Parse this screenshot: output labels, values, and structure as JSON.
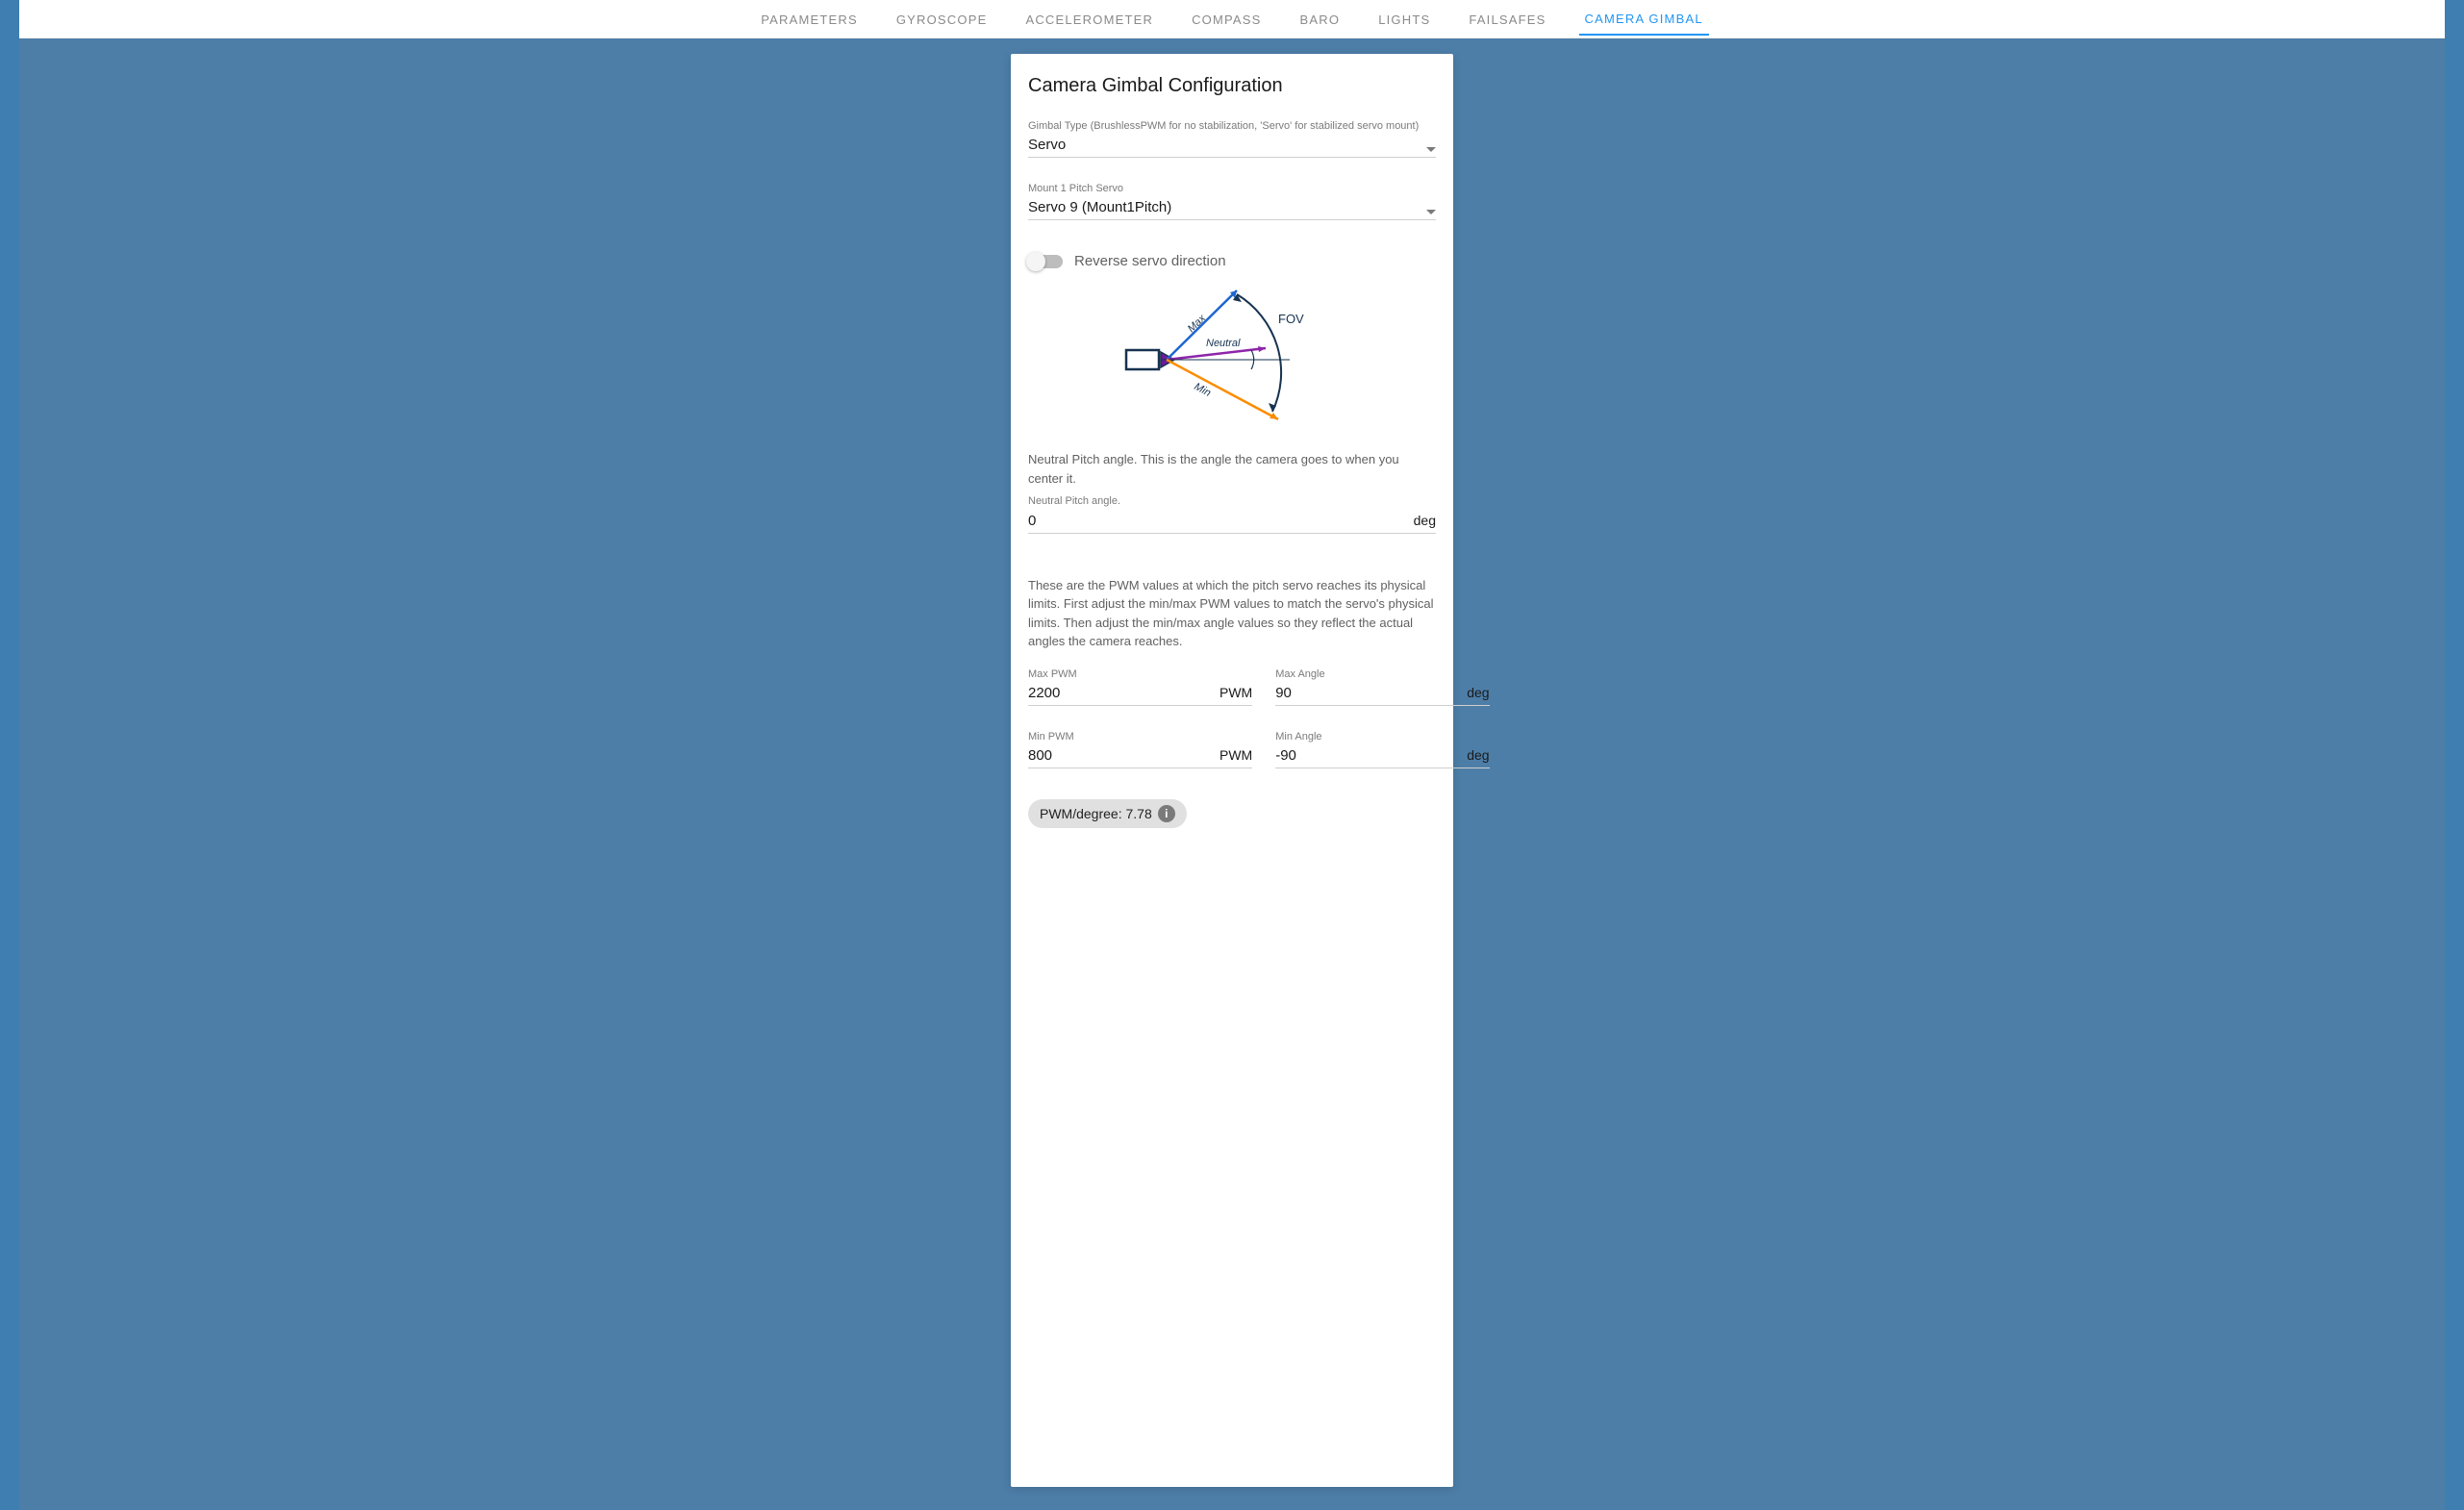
{
  "tabs": {
    "items": [
      {
        "label": "PARAMETERS"
      },
      {
        "label": "GYROSCOPE"
      },
      {
        "label": "ACCELEROMETER"
      },
      {
        "label": "COMPASS"
      },
      {
        "label": "BARO"
      },
      {
        "label": "LIGHTS"
      },
      {
        "label": "FAILSAFES"
      },
      {
        "label": "CAMERA GIMBAL"
      }
    ],
    "active_index": 7
  },
  "card": {
    "title": "Camera Gimbal Configuration",
    "gimbal_type": {
      "label": "Gimbal Type (BrushlessPWM for no stabilization, 'Servo' for stabilized servo mount)",
      "value": "Servo"
    },
    "mount_servo": {
      "label": "Mount 1 Pitch Servo",
      "value": "Servo 9 (Mount1Pitch)"
    },
    "reverse_toggle": {
      "label": "Reverse servo direction"
    },
    "diagram": {
      "max": "Max",
      "min": "Min",
      "neutral": "Neutral",
      "fov": "FOV"
    },
    "neutral_help": "Neutral Pitch angle. This is the angle the camera goes to when you center it.",
    "neutral_angle": {
      "label": "Neutral Pitch angle.",
      "value": "0",
      "suffix": "deg"
    },
    "pwm_help": "These are the PWM values at which the pitch servo reaches its physical limits. First adjust the min/max PWM values to match the servo's physical limits. Then adjust the min/max angle values so they reflect the actual angles the camera reaches.",
    "max_pwm": {
      "label": "Max PWM",
      "value": "2200",
      "suffix": "PWM"
    },
    "max_angle": {
      "label": "Max Angle",
      "value": "90",
      "suffix": "deg"
    },
    "min_pwm": {
      "label": "Min PWM",
      "value": "800",
      "suffix": "PWM"
    },
    "min_angle": {
      "label": "Min Angle",
      "value": "-90",
      "suffix": "deg"
    },
    "chip": {
      "text": "PWM/degree: 7.78"
    }
  }
}
